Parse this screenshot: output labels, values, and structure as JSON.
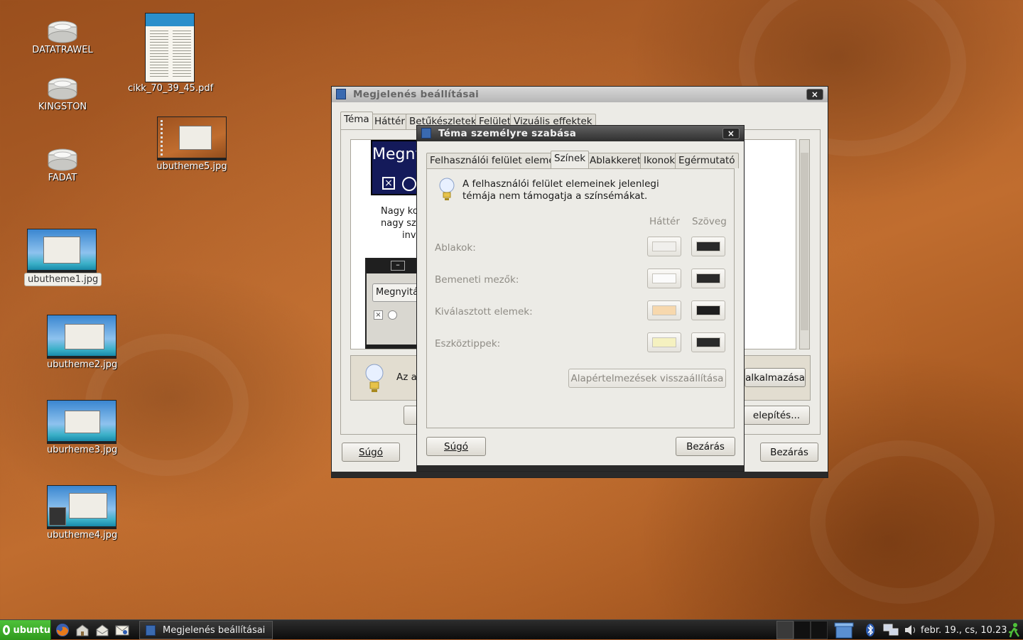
{
  "desktop": {
    "icons": [
      {
        "label": "DATATRAWEL"
      },
      {
        "label": "KINGSTON"
      },
      {
        "label": "FADAT"
      },
      {
        "label": "cikk_70_39_45.pdf"
      },
      {
        "label": "ubutheme5.jpg"
      },
      {
        "label": "ubutheme1.jpg"
      },
      {
        "label": "ubutheme2.jpg"
      },
      {
        "label": "uburheme3.jpg"
      },
      {
        "label": "ubutheme4.jpg"
      }
    ]
  },
  "appearance_window": {
    "title": "Megjelenés beállításai",
    "close_glyph": "×",
    "tabs": [
      "Téma",
      "Háttér",
      "Betűkészletek",
      "Felület",
      "Vizuális effektek"
    ],
    "preview_text": "Megny",
    "preview_lines": [
      "Nagy ko",
      "nagy sz",
      "inve"
    ],
    "preview_button": "Megnyitá",
    "info_text": "Az a",
    "apply_button": "alkalmazása",
    "install_button": "elepítés...",
    "help_button": "Súgó",
    "close_button": "Bezárás"
  },
  "customize_dialog": {
    "title": "Téma személyre szabása",
    "close_glyph": "×",
    "tabs": [
      "Felhasználói felület elemei",
      "Színek",
      "Ablakkeret",
      "Ikonok",
      "Egérmutató"
    ],
    "info_message_line1": "A felhasználói felület elemeinek jelenlegi",
    "info_message_line2": "témája nem támogatja a színsémákat.",
    "column_headers": {
      "background": "Háttér",
      "text": "Szöveg"
    },
    "rows": [
      {
        "label": "Ablakok:",
        "bg_color": "#f0efec",
        "text_color": "#2a2a2a"
      },
      {
        "label": "Bemeneti mezők:",
        "bg_color": "#fbfbfb",
        "text_color": "#2a2a2a"
      },
      {
        "label": "Kiválasztott elemek:",
        "bg_color": "#f7d8ad",
        "text_color": "#1e1e1e"
      },
      {
        "label": "Eszköztippek:",
        "bg_color": "#f5f1c0",
        "text_color": "#2a2a2a"
      }
    ],
    "reset_button": "Alapértelmezések visszaállítása",
    "help_button": "Súgó",
    "close_button": "Bezárás"
  },
  "taskbar": {
    "start_label": "ubuntu",
    "task_label": "Megjelenés beállításai",
    "clock": "febr. 19., cs, 10.23"
  },
  "colors": {
    "accent": "#3a6ab0",
    "start_button": "#2f9a1d",
    "titlebar_dark": "#2f2f2f"
  }
}
